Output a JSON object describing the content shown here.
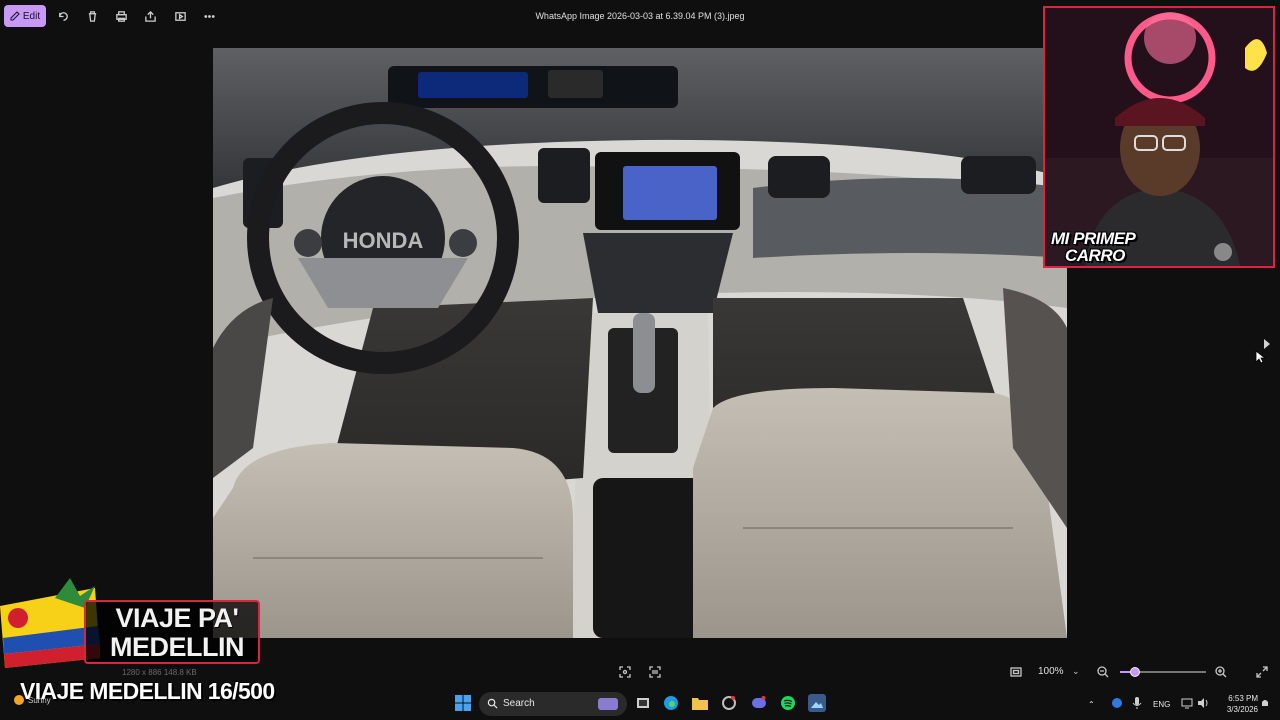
{
  "toolbar": {
    "edit_label": "Edit",
    "file_title": "WhatsApp Image 2026-03-03 at 6.39.04 PM (3).jpeg",
    "icons": [
      "rotate-icon",
      "delete-icon",
      "print-icon",
      "share-icon",
      "slideshow-icon",
      "more-icon"
    ]
  },
  "photo": {
    "badge": "HONDA"
  },
  "webcam": {
    "caption_line1": "MI PRIMEP",
    "caption_line2": "CARRO"
  },
  "overlay": {
    "banner_text": "VIAJE PA' MEDELLIN",
    "counter": "VIAJE MEDELLIN 16/500",
    "file_meta": "1280 x 886     148.8 KB"
  },
  "weather": {
    "condition": "Sunny"
  },
  "viewer": {
    "zoom": "100%",
    "zoom_fraction": 0.17
  },
  "taskbar": {
    "search_placeholder": "Search",
    "language": "ENG",
    "time": "6:53 PM",
    "date": "3/3/2026"
  },
  "colors": {
    "accent": "#c79af5",
    "webcam_border": "#e0213f",
    "background": "#0f0f0f"
  }
}
